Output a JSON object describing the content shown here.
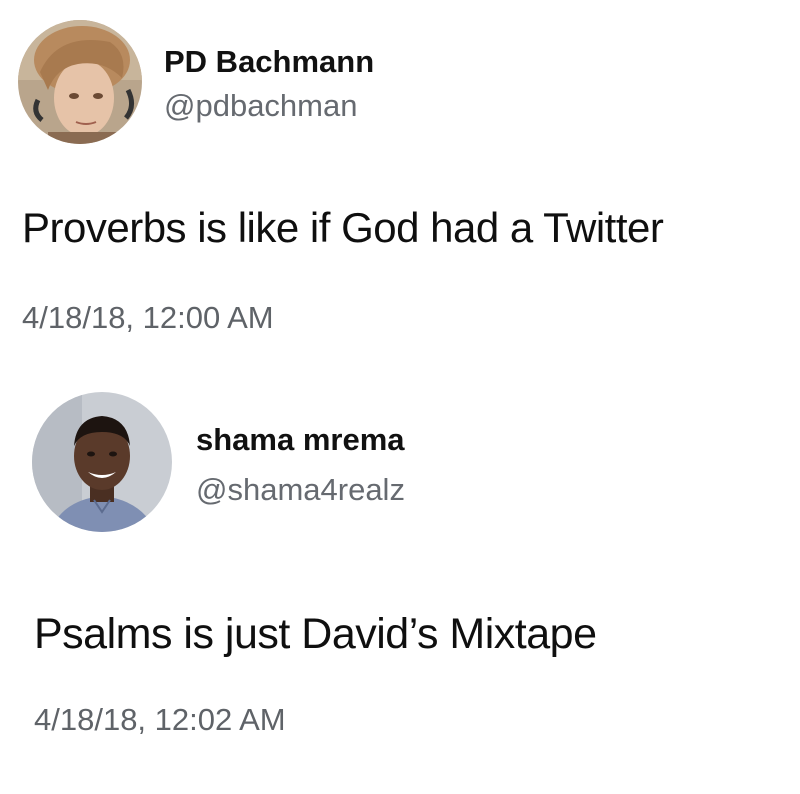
{
  "tweets": [
    {
      "display_name": "PD Bachmann",
      "handle": "@pdbachman",
      "text": "Proverbs is like if God had a Twitter",
      "timestamp": "4/18/18, 12:00 AM",
      "avatar_icon": "user-avatar-photo"
    },
    {
      "display_name": "shama mrema",
      "handle": "@shama4realz",
      "text": "Psalms is just David’s Mixtape",
      "timestamp": "4/18/18, 12:02 AM",
      "avatar_icon": "user-avatar-photo"
    }
  ],
  "colors": {
    "background": "#ffffff",
    "name": "#111111",
    "handle": "#666a70",
    "timestamp": "#5f6368"
  }
}
